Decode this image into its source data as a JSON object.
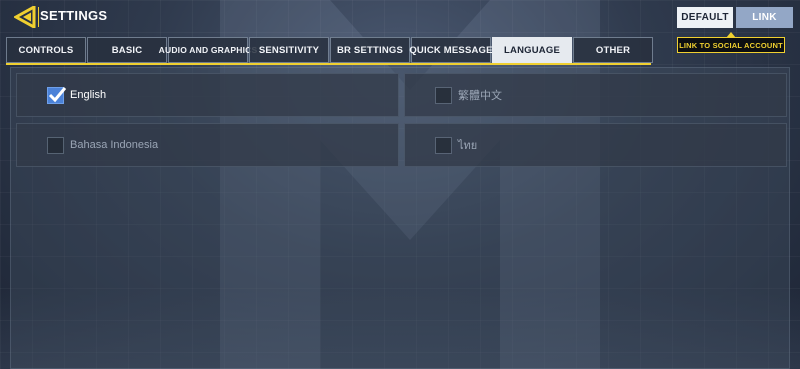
{
  "header": {
    "title": "SETTINGS",
    "default_label": "DEFAULT",
    "link_label": "LINK",
    "link_tooltip": "LINK TO SOCIAL ACCOUNT"
  },
  "tabs": [
    {
      "label": "CONTROLS",
      "active": false
    },
    {
      "label": "BASIC",
      "active": false
    },
    {
      "label": "AUDIO AND GRAPHICS",
      "active": false
    },
    {
      "label": "SENSITIVITY",
      "active": false
    },
    {
      "label": "BR SETTINGS",
      "active": false
    },
    {
      "label": "QUICK MESSAGE",
      "active": false
    },
    {
      "label": "LANGUAGE",
      "active": true
    },
    {
      "label": "OTHER",
      "active": false
    }
  ],
  "languages": [
    {
      "label": "English",
      "checked": true
    },
    {
      "label": "繁體中文",
      "checked": false
    },
    {
      "label": "Bahasa Indonesia",
      "checked": false
    },
    {
      "label": "ไทย",
      "checked": false
    }
  ],
  "colors": {
    "accent_yellow": "#f0d030",
    "checkbox_blue": "#4b82d8",
    "link_button": "#93a7c6"
  }
}
